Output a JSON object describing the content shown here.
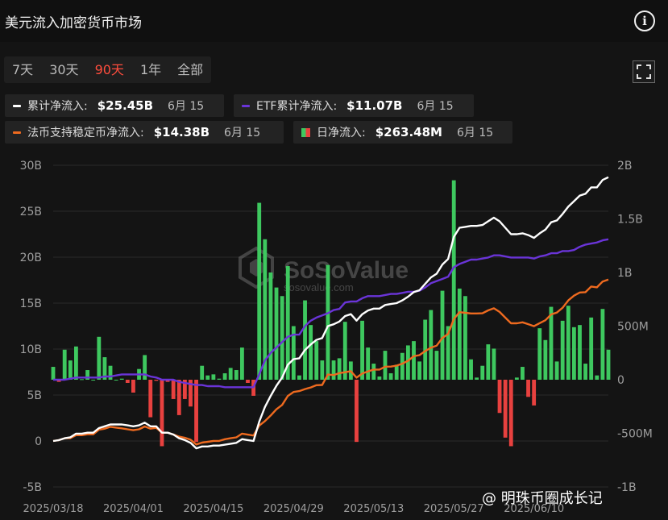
{
  "header": {
    "title": "美元流入加密货币市场",
    "info_icon": "i"
  },
  "ranges": [
    "7天",
    "30天",
    "90天",
    "1年",
    "全部"
  ],
  "active_range": "90天",
  "legend": [
    {
      "label": "累计净流入:",
      "value": "$25.45B",
      "date": "6月 15",
      "color": "#ffffff"
    },
    {
      "label": "ETF累计净流入:",
      "value": "$11.07B",
      "date": "6月 15",
      "color": "#6a34d8"
    },
    {
      "label": "法币支持稳定币净流入:",
      "value": "$14.38B",
      "date": "6月 15",
      "color": "#ee6a1f"
    },
    {
      "label": "日净流入:",
      "value": "$263.48M",
      "date": "6月 15",
      "color_pos": "#3ec85f",
      "color_neg": "#e8413f"
    }
  ],
  "watermark": {
    "logo": "SoSoValue",
    "url": "sosovalue.com"
  },
  "corner_watermark": "@ 明珠币圈成长记",
  "chart_data": {
    "type": "bar+line",
    "x_tick_labels": [
      "2025/03/18",
      "2025/04/01",
      "2025/04/15",
      "2025/04/29",
      "2025/05/13",
      "2025/05/27",
      "2025/06/10"
    ],
    "y_left": {
      "ticks": [
        "30B",
        "25B",
        "20B",
        "15B",
        "10B",
        "5B",
        "0",
        "-5B"
      ],
      "lim": [
        -5,
        30
      ]
    },
    "y_right": {
      "ticks": [
        "2B",
        "1.5B",
        "1B",
        "500M",
        "0",
        "-500M",
        "-1B"
      ],
      "lim": [
        -1,
        2
      ]
    },
    "daily_flow_millions": [
      120,
      -20,
      280,
      180,
      310,
      5,
      90,
      0,
      400,
      210,
      130,
      0,
      10,
      -30,
      -120,
      100,
      230,
      -350,
      -10,
      -620,
      -20,
      -180,
      -330,
      -180,
      -250,
      -580,
      130,
      40,
      50,
      10,
      60,
      110,
      90,
      300,
      -30,
      -150,
      1650,
      1310,
      1000,
      860,
      780,
      1060,
      500,
      40,
      740,
      510,
      360,
      180,
      1070,
      180,
      200,
      540,
      170,
      -580,
      550,
      300,
      150,
      30,
      270,
      60,
      140,
      250,
      320,
      360,
      170,
      560,
      650,
      270,
      830,
      500,
      1860,
      850,
      780,
      190,
      20,
      130,
      330,
      290,
      -310,
      -540,
      -620,
      20,
      120,
      -160,
      -240,
      480,
      370,
      680,
      170,
      550,
      690,
      490,
      510,
      150,
      580,
      40,
      660,
      280
    ],
    "cumulative_B": [
      0,
      0.1,
      0.3,
      0.4,
      0.8,
      0.8,
      0.9,
      0.9,
      1.4,
      1.6,
      1.8,
      1.8,
      1.8,
      1.7,
      1.6,
      1.7,
      2.0,
      1.6,
      1.6,
      0.9,
      0.9,
      0.7,
      0.3,
      0.1,
      -0.2,
      -0.8,
      -0.6,
      -0.6,
      -0.5,
      -0.5,
      -0.4,
      -0.3,
      -0.2,
      0.2,
      0.1,
      0.0,
      2.1,
      3.7,
      4.9,
      6.0,
      6.9,
      8.3,
      8.9,
      9.0,
      9.9,
      10.5,
      11.0,
      11.2,
      12.5,
      12.7,
      13.0,
      13.6,
      13.8,
      13.1,
      13.8,
      14.2,
      14.4,
      14.4,
      14.8,
      14.9,
      15.0,
      15.3,
      15.7,
      16.2,
      16.4,
      17.1,
      17.8,
      18.2,
      19.2,
      19.8,
      22.2,
      23.2,
      23.3,
      23.4,
      23.4,
      23.5,
      23.9,
      24.3,
      23.9,
      23.2,
      22.5,
      22.5,
      22.6,
      22.4,
      22.1,
      22.6,
      23.0,
      23.8,
      24.0,
      24.7,
      25.5,
      26.1,
      26.7,
      26.9,
      27.6,
      27.6,
      28.4,
      28.7
    ],
    "etf_cumulative_B": [
      0,
      0,
      0,
      0.01,
      0.02,
      0.02,
      0.02,
      0.02,
      0.02,
      0.03,
      0.03,
      0.04,
      0.05,
      0.05,
      0.05,
      0.05,
      0.05,
      0.03,
      0.02,
      0.0,
      0.0,
      0.0,
      -0.02,
      -0.03,
      -0.04,
      -0.05,
      -0.05,
      -0.06,
      -0.06,
      -0.06,
      -0.07,
      -0.07,
      -0.07,
      -0.07,
      -0.07,
      -0.07,
      0.05,
      0.18,
      0.25,
      0.3,
      0.35,
      0.4,
      0.42,
      0.42,
      0.5,
      0.55,
      0.58,
      0.6,
      0.62,
      0.65,
      0.66,
      0.72,
      0.73,
      0.73,
      0.76,
      0.78,
      0.78,
      0.78,
      0.79,
      0.8,
      0.8,
      0.81,
      0.82,
      0.82,
      0.83,
      0.86,
      0.9,
      0.92,
      0.94,
      0.96,
      1.05,
      1.08,
      1.1,
      1.12,
      1.12,
      1.13,
      1.14,
      1.16,
      1.16,
      1.15,
      1.14,
      1.14,
      1.14,
      1.14,
      1.13,
      1.15,
      1.16,
      1.18,
      1.18,
      1.2,
      1.2,
      1.21,
      1.24,
      1.26,
      1.27,
      1.28,
      1.3,
      1.31
    ]
  }
}
